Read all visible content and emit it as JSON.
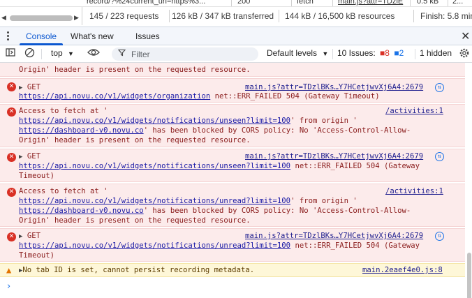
{
  "network_row": {
    "name": "record/?%24current_url=https%3...",
    "status": "200",
    "type": "fetch",
    "initiator": "main.js?attr=TDzlE",
    "size": "0.5 kB",
    "time": "2..."
  },
  "summary": {
    "requests": "145 / 223 requests",
    "transferred": "126 kB / 347 kB transferred",
    "resources": "144 kB / 16,500 kB resources",
    "finish": "Finish: 5.8 min"
  },
  "drawer_tabs": {
    "console": "Console",
    "whats_new": "What's new",
    "issues": "Issues"
  },
  "toolbar": {
    "context": "top",
    "filter_placeholder": "Filter",
    "levels": "Default levels",
    "issues_label": "10 Issues:",
    "error_count": "8",
    "info_count": "2",
    "hidden": "1 hidden"
  },
  "messages": [
    {
      "type": "error",
      "lines": [
        "Origin' header is present on the requested resource."
      ]
    },
    {
      "type": "error",
      "method": "GET",
      "source": "main.js?attr=TDzlBKs…Y7HCetjwvXj6A4:2679",
      "url": "https://api.novu.co/v1/widgets/organization",
      "error": " net::ERR_FAILED 504 (Gateway Timeout)"
    },
    {
      "type": "error",
      "prefix": "Access to fetch at '",
      "source": "/activities:1",
      "url": "https://api.novu.co/v1/widgets/notifications/unseen?limit=100",
      "mid": "' from origin '",
      "origin": "https://dashboard-v0.novu.co",
      "suffix": "' has been blocked by CORS policy: No 'Access-Control-Allow-",
      "last": "Origin' header is present on the requested resource."
    },
    {
      "type": "error",
      "method": "GET",
      "source": "main.js?attr=TDzlBKs…Y7HCetjwvXj6A4:2679",
      "url": "https://api.novu.co/v1/widgets/notifications/unseen?limit=100",
      "error": " net::ERR_FAILED 504 (Gateway",
      "error2": "Timeout)"
    },
    {
      "type": "error",
      "prefix": "Access to fetch at '",
      "source": "/activities:1",
      "url": "https://api.novu.co/v1/widgets/notifications/unread?limit=100",
      "mid": "' from origin '",
      "origin": "https://dashboard-v0.novu.co",
      "suffix": "' has been blocked by CORS policy: No 'Access-Control-Allow-",
      "last": "Origin' header is present on the requested resource."
    },
    {
      "type": "error",
      "method": "GET",
      "source": "main.js?attr=TDzlBKs…Y7HCetjwvXj6A4:2679",
      "url": "https://api.novu.co/v1/widgets/notifications/unread?limit=100",
      "error": " net::ERR_FAILED 504 (Gateway",
      "error2": "Timeout)"
    },
    {
      "type": "warning",
      "text": "No tab ID is set, cannot persist recording metadata.",
      "source": "main.2eaef4e0.js:8"
    }
  ],
  "prompt": "›",
  "icons": {
    "kebab": "kebab-menu-icon",
    "close": "close-icon",
    "sidebar": "sidebar-toggle-icon",
    "clear": "clear-console-icon",
    "eye": "live-expression-eye-icon",
    "filter": "filter-funnel-icon",
    "gear": "settings-gear-icon"
  },
  "colors": {
    "error_bg": "#fcebeb",
    "warning_bg": "#fef7d8",
    "accent": "#0b57d0"
  }
}
